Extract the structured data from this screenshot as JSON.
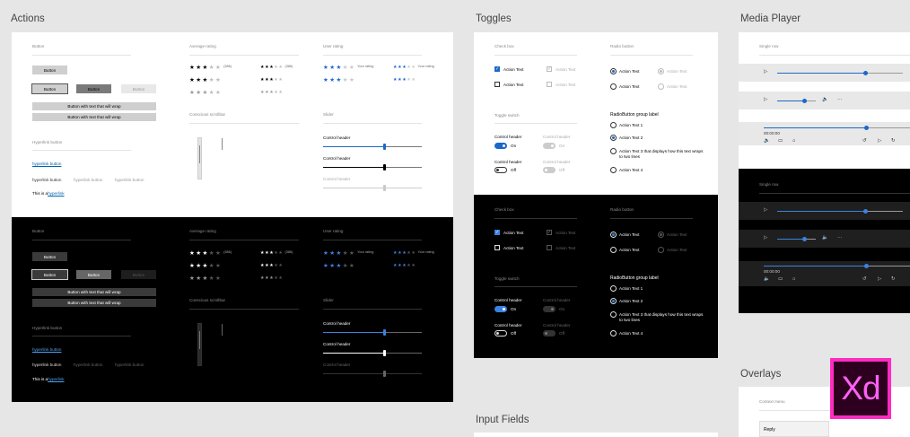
{
  "sections": {
    "actions": "Actions",
    "toggles": "Toggles",
    "media": "Media Player",
    "overlays": "Overlays",
    "input_fields": "Input Fields"
  },
  "actions": {
    "button_title": "Button",
    "button_label": "Button",
    "wrap_label": "Button with text that will wrap",
    "hyperlink_title": "Hyperlink button",
    "hyperlink_label": "hyperlink button",
    "inline_prefix": "This is a",
    "inline_link": "hyperlink",
    "avg_title": "Average rating",
    "avg_count": "(386)",
    "user_title": "User rating",
    "user_caption": "Your rating",
    "scroll_title": "Conscious scrollbar",
    "slider_title": "Slider",
    "slider_header": "Control header"
  },
  "ratings": {
    "avg": [
      3,
      3,
      3
    ],
    "avg_small": [
      3,
      3,
      3
    ],
    "user": [
      3,
      3
    ],
    "user_small": [
      3,
      3
    ],
    "max": 5
  },
  "sliders": {
    "values": [
      0.62,
      0.62,
      0.62
    ]
  },
  "toggles": {
    "checkbox_title": "Check box",
    "radio_title": "Radio button",
    "action_text": "Action Text",
    "toggle_title": "Toggle switch",
    "control_header": "Control header",
    "on": "On",
    "off": "Off",
    "group_label": "RadioButton group label",
    "r1": "Action Text 1",
    "r2": "Action Text 2",
    "r3": "Action Text 3 that displays how this text wraps to two lines",
    "r4": "Action Text 4"
  },
  "media": {
    "title": "Single row",
    "time": "00:00:00",
    "progress": [
      0.7,
      0.7,
      0.7
    ]
  },
  "overlays": {
    "context_title": "Context menu",
    "reply": "Reply"
  },
  "xd_logo": "Xd",
  "colors": {
    "accent": "#1b68c8",
    "accent_dark": "#3b82e0",
    "xd_pink": "#ff2bc2",
    "xd_bg": "#2e001f"
  }
}
